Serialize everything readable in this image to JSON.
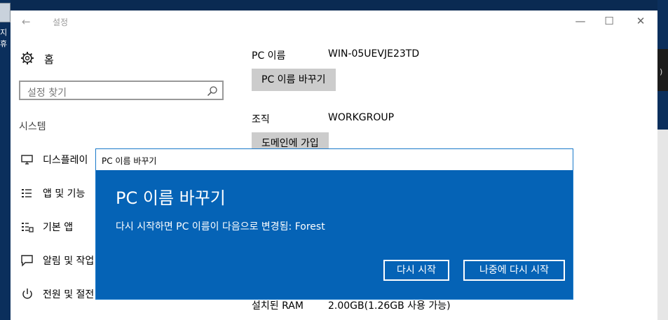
{
  "desktop": {
    "left_label": "지휴",
    "right_mark": ")"
  },
  "window": {
    "title": "설정",
    "back_label": "←",
    "minimize_label": "—",
    "maximize_label": "☐",
    "close_label": "✕"
  },
  "sidebar": {
    "home_label": "홈",
    "search_placeholder": "설정 찾기",
    "section_title": "시스템",
    "items": [
      {
        "label": "디스플레이",
        "icon": "monitor-icon"
      },
      {
        "label": "앱 및 기능",
        "icon": "apps-list-icon"
      },
      {
        "label": "기본 앱",
        "icon": "default-apps-icon"
      },
      {
        "label": "알림 및 작업",
        "icon": "notification-icon"
      },
      {
        "label": "전원 및 절전",
        "icon": "power-icon"
      }
    ]
  },
  "main": {
    "pc_name_label": "PC 이름",
    "pc_name_value": "WIN-05UEVJE23TD",
    "rename_button": "PC 이름 바꾸기",
    "org_label": "조직",
    "org_value": "WORKGROUP",
    "join_domain_button": "도메인에 가입",
    "ram_label": "설치된 RAM",
    "ram_value": "2.00GB(1.26GB 사용 가능)"
  },
  "dialog": {
    "window_title": "PC 이름 바꾸기",
    "heading": "PC 이름 바꾸기",
    "message": "다시 시작하면 PC 이름이 다음으로 변경됨: Forest",
    "restart_now_button": "다시 시작",
    "restart_later_button": "나중에 다시 시작",
    "accent_color": "#0563b6"
  }
}
